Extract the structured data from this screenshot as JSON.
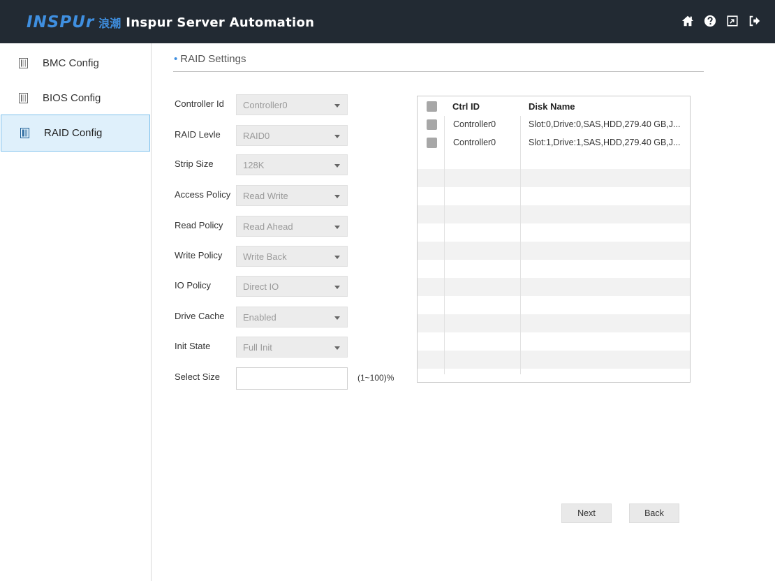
{
  "header": {
    "logo_en": "INSPUr",
    "logo_cn": "浪潮",
    "title": "Inspur Server Automation",
    "icons": [
      "home-icon",
      "help-icon",
      "export-icon",
      "logout-icon"
    ]
  },
  "sidebar": {
    "items": [
      {
        "label": "BMC Config",
        "icon": "server-config-icon",
        "active": false
      },
      {
        "label": "BIOS Config",
        "icon": "server-config-icon",
        "active": false
      },
      {
        "label": "RAID Config",
        "icon": "server-config-icon",
        "active": true
      }
    ]
  },
  "main": {
    "section_title": "RAID Settings",
    "form": {
      "controller_id": {
        "label": "Controller Id",
        "value": "Controller0"
      },
      "raid_level": {
        "label": "RAID Levle",
        "value": "RAID0"
      },
      "strip_size": {
        "label": "Strip Size",
        "value": "128K"
      },
      "access_policy": {
        "label": "Access Policy",
        "value": "Read Write"
      },
      "read_policy": {
        "label": "Read Policy",
        "value": "Read Ahead"
      },
      "write_policy": {
        "label": "Write Policy",
        "value": "Write Back"
      },
      "io_policy": {
        "label": "IO Policy",
        "value": "Direct IO"
      },
      "drive_cache": {
        "label": "Drive Cache",
        "value": "Enabled"
      },
      "init_state": {
        "label": "Init State",
        "value": "Full Init"
      },
      "select_size": {
        "label": "Select Size",
        "value": "",
        "hint": "(1~100)%"
      }
    },
    "disk_table": {
      "columns": [
        "Ctrl ID",
        "Disk Name"
      ],
      "rows": [
        {
          "ctrl_id": "Controller0",
          "disk_name": "Slot:0,Drive:0,SAS,HDD,279.40 GB,J..."
        },
        {
          "ctrl_id": "Controller0",
          "disk_name": "Slot:1,Drive:1,SAS,HDD,279.40 GB,J..."
        }
      ]
    },
    "buttons": {
      "next": "Next",
      "back": "Back"
    }
  },
  "colors": {
    "header_bg": "#222a33",
    "brand_blue": "#3f8fe0",
    "active_bg": "#dff0fb",
    "active_border": "#7ec1ec"
  }
}
